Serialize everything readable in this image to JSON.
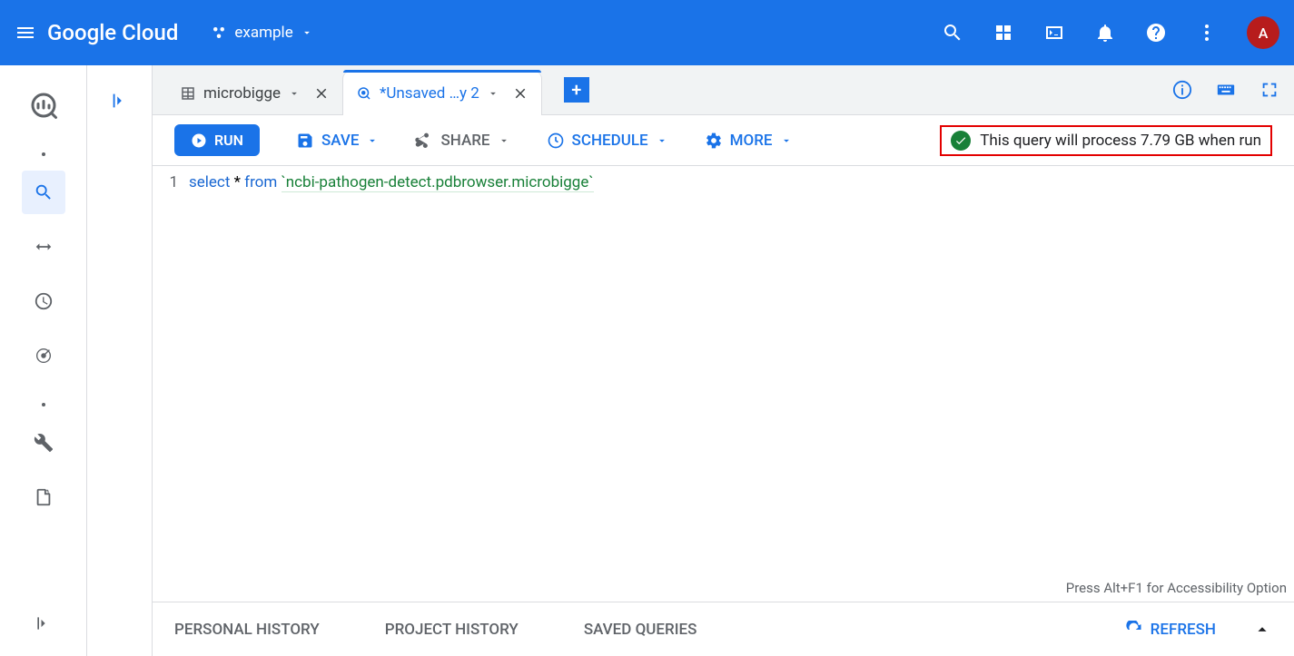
{
  "header": {
    "logo": "Google Cloud",
    "project": "example",
    "avatar_letter": "A"
  },
  "tabs": [
    {
      "label": "microbigge",
      "active": false
    },
    {
      "label": "*Unsaved …y 2",
      "active": true
    }
  ],
  "toolbar": {
    "run": "RUN",
    "save": "SAVE",
    "share": "SHARE",
    "schedule": "SCHEDULE",
    "more": "MORE"
  },
  "status": "This query will process 7.79 GB when run",
  "editor": {
    "line_number": "1",
    "kw_select": "select",
    "star": "*",
    "kw_from": "from",
    "src": "`ncbi-pathogen-detect.pdbrowser.microbigge`"
  },
  "accessibility_hint": "Press Alt+F1 for Accessibility Option",
  "bottom": {
    "personal": "PERSONAL HISTORY",
    "project": "PROJECT HISTORY",
    "saved": "SAVED QUERIES",
    "refresh": "REFRESH"
  }
}
